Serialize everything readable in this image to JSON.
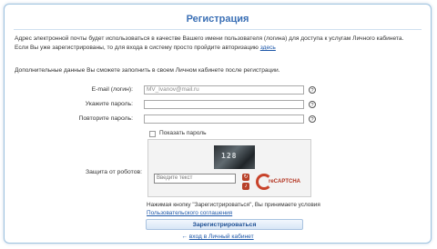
{
  "title": "Регистрация",
  "intro": {
    "text": "Адрес электронной почты будет использоваться в качестве Вашего имени пользователя (логина) для доступа к услугам Личного кабинета. Если Вы уже зарегистрированы, то для входа в систему просто пройдите авторизацию",
    "link": "здесь"
  },
  "extra_note": "Дополнительные данные Вы сможете заполнить в своем Личном кабинете после регистрации.",
  "fields": {
    "email_label": "E-mail (логин):",
    "email_value": "MV_Ivanov@mail.ru",
    "password_label": "Укажите пароль:",
    "password_repeat_label": "Повторите пароль:",
    "help_glyph": "?"
  },
  "show_password_label": "Показать пароль",
  "captcha": {
    "label": "Защита от роботов:",
    "image_text": "128",
    "input_placeholder": "Введите текст",
    "logo_text": "reCAPTCHA"
  },
  "agreement": {
    "text": "Нажимая кнопку \"Зарегистрироваться\", Вы принимаете условия",
    "link": "Пользовательского соглашения"
  },
  "submit_label": "Зарегистрироваться",
  "back_link": {
    "arrow": "←",
    "text": "вход в Личный кабинет"
  }
}
